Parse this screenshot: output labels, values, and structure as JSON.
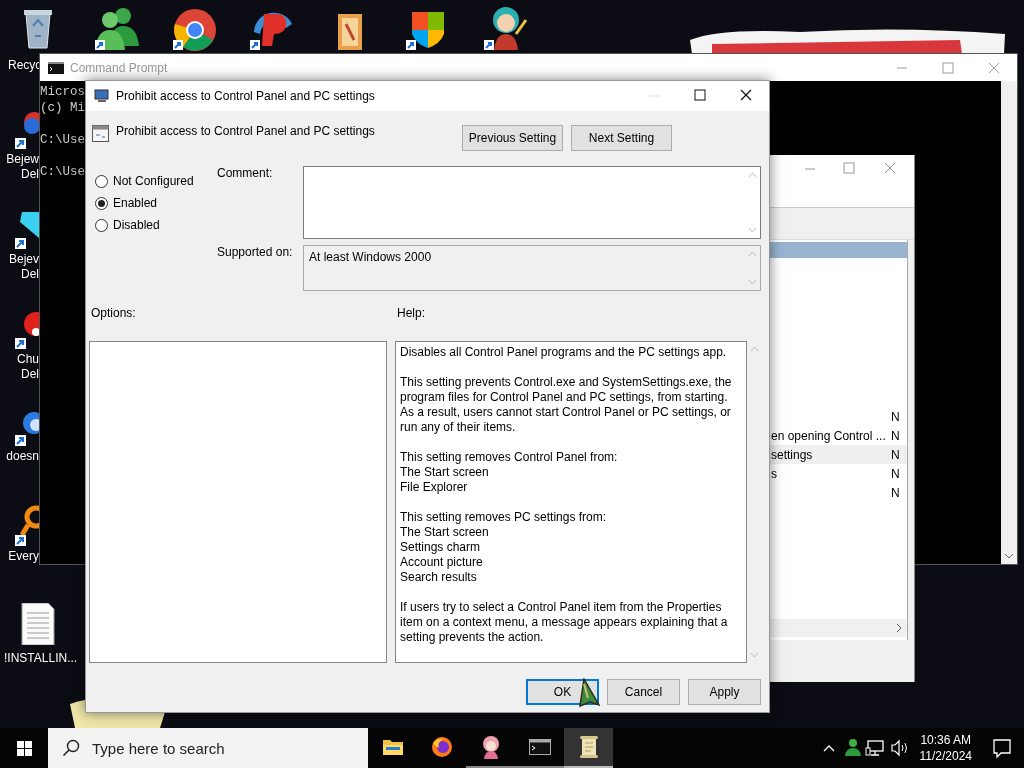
{
  "desktop": {
    "recycle_label": "Recyc",
    "left_icons": [
      {
        "lines": [
          "Bejew",
          "Del"
        ]
      },
      {
        "lines": [
          "Bejev",
          "Del"
        ]
      },
      {
        "lines": [
          "Chu",
          "Del"
        ]
      },
      {
        "lines": [
          "doesn"
        ]
      },
      {
        "lines": [
          "Every"
        ]
      },
      {
        "lines": [
          "!INSTALLIN..."
        ]
      }
    ]
  },
  "cmd": {
    "title": "Command Prompt",
    "lines": [
      {
        "text": "Micros",
        "blank_before": false
      },
      {
        "text": "(c) Mi",
        "blank_before": false
      },
      {
        "text": "C:\\Use",
        "blank_before": true
      },
      {
        "text": "C:\\Use",
        "blank_before": true
      }
    ]
  },
  "policy_editor": {
    "rows": [
      {
        "name": "",
        "state": "N",
        "selected": false
      },
      {
        "name": "en opening Control ...",
        "state": "N",
        "selected": false
      },
      {
        "name": "settings",
        "state": "N",
        "selected": true
      },
      {
        "name": "s",
        "state": "N",
        "selected": false
      },
      {
        "name": "",
        "state": "N",
        "selected": false
      }
    ]
  },
  "dialog": {
    "title": "Prohibit access to Control Panel and PC settings",
    "heading": "Prohibit access to Control Panel and PC settings",
    "nav_buttons": [
      "Previous Setting",
      "Next Setting"
    ],
    "options": [
      {
        "label": "Not Configured",
        "selected": false
      },
      {
        "label": "Enabled",
        "selected": true
      },
      {
        "label": "Disabled",
        "selected": false
      }
    ],
    "comment_label": "Comment:",
    "supported_label": "Supported on:",
    "supported_value": "At least Windows 2000",
    "options_label": "Options:",
    "help_label": "Help:",
    "help": [
      {
        "lines": [
          "Disables all Control Panel programs and the PC settings app."
        ]
      },
      {
        "lines": [
          "This setting prevents Control.exe and SystemSettings.exe, the program files for Control Panel and PC settings, from starting. As a result, users cannot start Control Panel or PC settings, or run any of their items."
        ]
      },
      {
        "lines": [
          "This setting removes Control Panel from:",
          "The Start screen",
          "File Explorer"
        ]
      },
      {
        "lines": [
          "This setting removes PC settings from:",
          "The Start screen",
          "Settings charm",
          "Account picture",
          "Search results"
        ]
      },
      {
        "lines": [
          "If users try to select a Control Panel item from the Properties item on a context menu, a message appears explaining that a setting prevents the action."
        ]
      }
    ],
    "footer_buttons": [
      {
        "label": "OK",
        "focused": true
      },
      {
        "label": "Cancel",
        "focused": false
      },
      {
        "label": "Apply",
        "focused": false
      }
    ]
  },
  "taskbar": {
    "search_placeholder": "Type here to search",
    "apps": [
      {
        "running": false,
        "active": false
      },
      {
        "running": false,
        "active": false
      },
      {
        "running": true,
        "active": false
      },
      {
        "running": true,
        "active": false
      },
      {
        "running": true,
        "active": true
      }
    ],
    "time": "10:36 AM",
    "date": "11/2/2024"
  }
}
